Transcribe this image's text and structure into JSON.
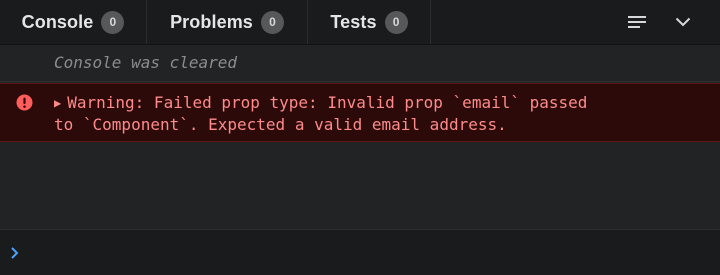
{
  "tabs": [
    {
      "label": "Console",
      "count": "0"
    },
    {
      "label": "Problems",
      "count": "0"
    },
    {
      "label": "Tests",
      "count": "0"
    }
  ],
  "toolbar": {
    "wrap_icon": "text-wrap-icon",
    "collapse_icon": "chevron-down-icon"
  },
  "log": {
    "cleared_message": "Console was cleared",
    "warning": {
      "icon": "error-icon",
      "text": "Warning: Failed prop type: Invalid prop `email` passed\nto `Component`. Expected a valid email address."
    }
  },
  "prompt": {
    "icon": "prompt-chevron-icon",
    "value": ""
  },
  "colors": {
    "background": "#222324",
    "tabbar": "#1a1b1c",
    "warning_bg": "#2c0a0a",
    "warning_text": "#ff8a8a",
    "error_icon": "#ff5c5c",
    "prompt_chevron": "#4aa3ff",
    "muted_text": "#8a8c8e"
  }
}
